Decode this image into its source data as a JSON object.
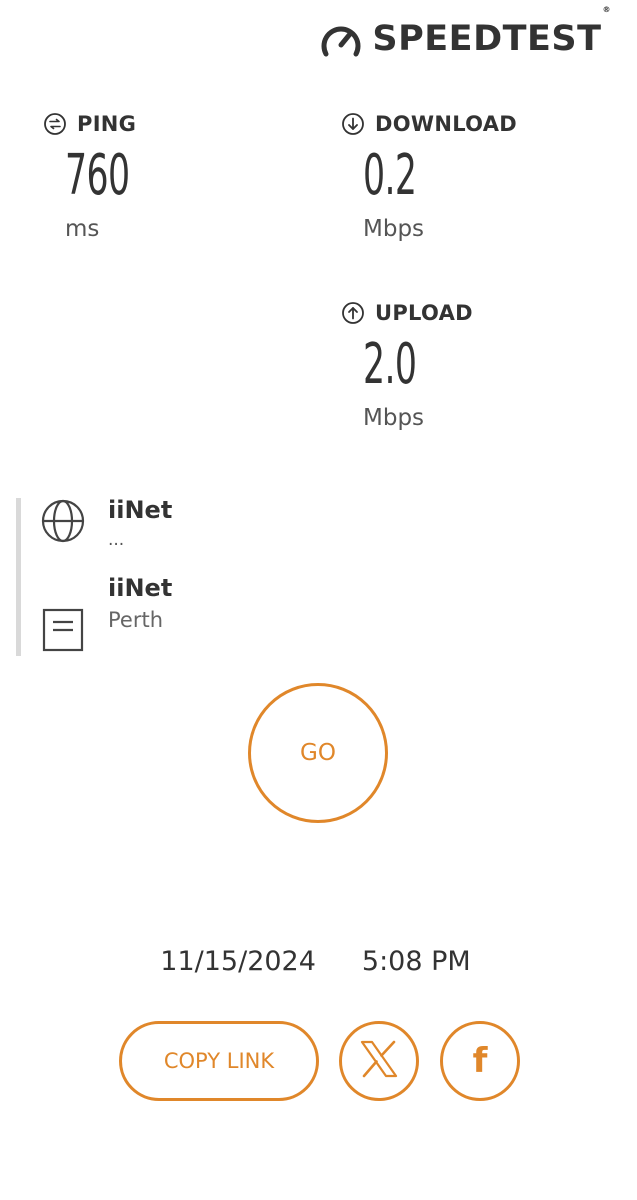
{
  "brand": {
    "name": "SPEEDTEST",
    "registered_mark": "®",
    "logo_icon": "gauge-icon"
  },
  "metrics": {
    "ping": {
      "label": "PING",
      "value": "760",
      "unit": "ms",
      "icon": "ping-icon"
    },
    "download": {
      "label": "DOWNLOAD",
      "value": "0.2",
      "unit": "Mbps",
      "icon": "arrow-down-circle-icon"
    },
    "upload": {
      "label": "UPLOAD",
      "value": "2.0",
      "unit": "Mbps",
      "icon": "arrow-up-circle-icon"
    }
  },
  "connection": {
    "isp_name": "iiNet",
    "isp_ip": "...",
    "isp_icon": "globe-icon",
    "server_name": "iiNet",
    "server_location": "Perth",
    "server_icon": "server-icon"
  },
  "go_button": {
    "label": "GO"
  },
  "result": {
    "date": "11/15/2024",
    "time": "5:08 PM"
  },
  "share": {
    "copy_link_label": "COPY LINK",
    "x_icon": "x-logo-icon",
    "facebook_icon": "facebook-icon",
    "facebook_glyph": "f"
  },
  "colors": {
    "accent": "#e0872a",
    "text": "#333333",
    "muted": "#666666",
    "divider": "#d9d9d9"
  }
}
